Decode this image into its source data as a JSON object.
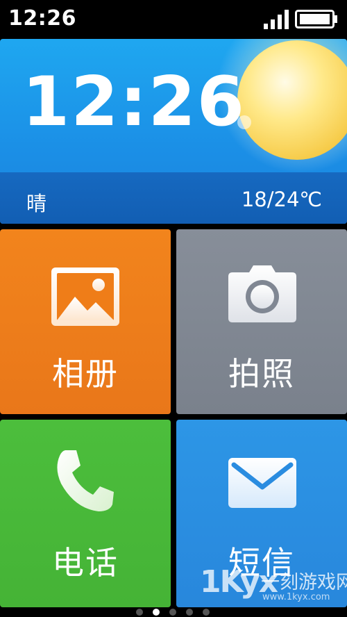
{
  "status_bar": {
    "time": "12:26",
    "signal_icon": "signal-bars-icon",
    "battery_icon": "battery-icon"
  },
  "weather": {
    "time": "12:26",
    "condition": "晴",
    "temperature": "18/24℃",
    "icon": "sun-icon"
  },
  "tiles": {
    "album": {
      "label": "相册",
      "icon": "gallery-icon",
      "color": "#f2841c"
    },
    "camera": {
      "label": "拍照",
      "icon": "camera-icon",
      "color": "#878e99"
    },
    "phone": {
      "label": "电话",
      "icon": "phone-icon",
      "color": "#4cbe3c"
    },
    "sms": {
      "label": "短信",
      "icon": "envelope-icon",
      "color": "#2d96e6"
    }
  },
  "pager": {
    "count": 5,
    "active_index": 1
  },
  "watermark": {
    "logo": "1Kyx",
    "text": "一刻游戏网",
    "url": "www.1kyx.com"
  }
}
